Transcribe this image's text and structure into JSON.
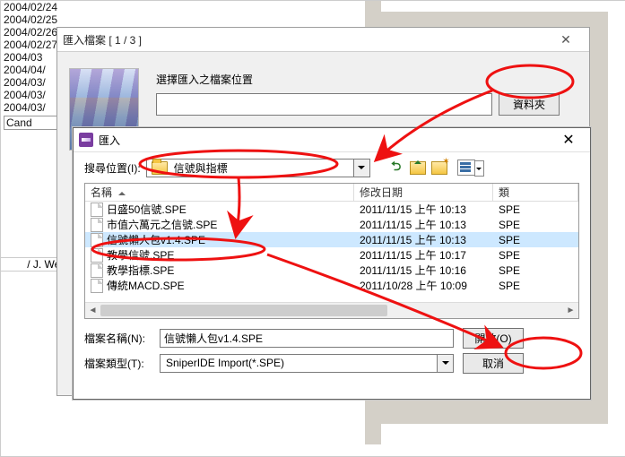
{
  "background": {
    "dates": [
      "2004/02/24",
      "2004/02/25",
      "2004/02/26",
      "2004/02/27",
      "2004/03",
      "2004/04/",
      "2004/03/",
      "2004/03/",
      "2004/03/"
    ],
    "candlestick_label": "Cand",
    "welles": "/ J. Welles W"
  },
  "dlg1": {
    "title": "匯入檔案 [ 1 / 3 ]",
    "location_label": "選擇匯入之檔案位置",
    "location_value": "",
    "folder_btn": "資料夾"
  },
  "dlg2": {
    "title": "匯入",
    "search_label": "搜尋位置(I):",
    "current_folder": "信號與指標",
    "columns": {
      "name": "名稱",
      "date": "修改日期",
      "type": "類"
    },
    "files": [
      {
        "name": "日盛50信號.SPE",
        "date": "2011/11/15 上午 10:13",
        "type": "SPE"
      },
      {
        "name": "市值六萬元之信號.SPE",
        "date": "2011/11/15 上午 10:13",
        "type": "SPE"
      },
      {
        "name": "信號懶人包v1.4.SPE",
        "date": "2011/11/15 上午 10:13",
        "type": "SPE",
        "selected": true
      },
      {
        "name": "教學信號.SPE",
        "date": "2011/11/15 上午 10:17",
        "type": "SPE"
      },
      {
        "name": "教學指標.SPE",
        "date": "2011/11/15 上午 10:16",
        "type": "SPE"
      },
      {
        "name": "傳統MACD.SPE",
        "date": "2011/10/28 上午 10:09",
        "type": "SPE"
      }
    ],
    "name_label": "檔案名稱(N):",
    "name_value": "信號懶人包v1.4.SPE",
    "type_label": "檔案類型(T):",
    "type_value": "SniperIDE Import(*.SPE)",
    "open_btn": "開啟(O)",
    "cancel_btn": "取消"
  }
}
